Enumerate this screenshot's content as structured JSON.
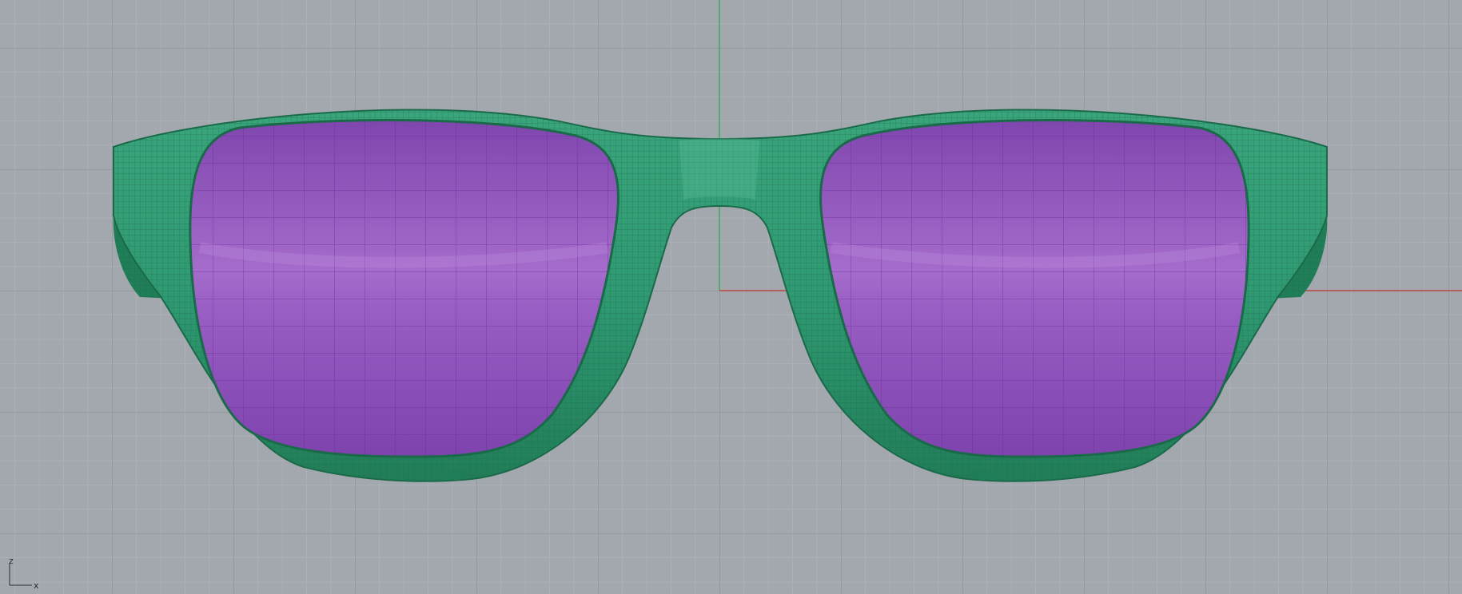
{
  "viewport": {
    "background": "#a3a8ae",
    "grid_minor_color": "#b4b9be",
    "grid_major_color": "#8f949a",
    "world_x_axis_color": "#c0362c",
    "world_y_axis_color": "#34a853"
  },
  "model": {
    "frame_color": "#2f9a72",
    "frame_dark_color": "#1f7d57",
    "lens_color": "#9a63c2",
    "lens_dark_color": "#7e43ad",
    "mesh_line_color": "#6c2e9e"
  },
  "axis_gizmo": {
    "z_label": "z",
    "x_label": "x"
  }
}
